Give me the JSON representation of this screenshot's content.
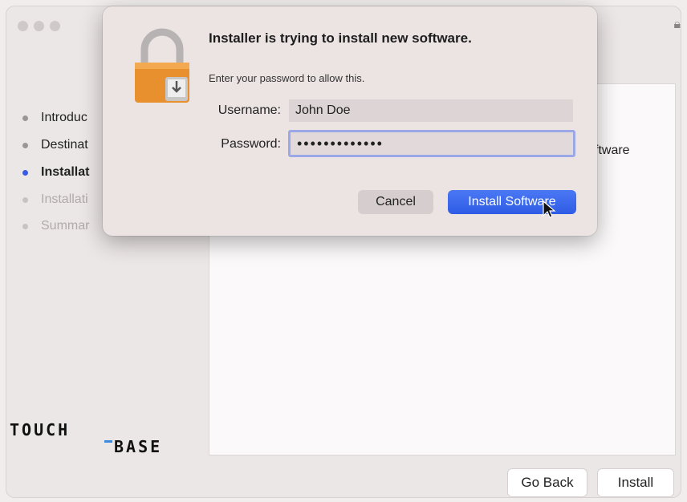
{
  "window": {
    "steps": [
      {
        "label": "Introduc",
        "state": "done"
      },
      {
        "label": "Destinat",
        "state": "done"
      },
      {
        "label": "Installat",
        "state": "active"
      },
      {
        "label": "Installati",
        "state": "pending"
      },
      {
        "label": "Summar",
        "state": "pending"
      }
    ],
    "content_text": "ftware",
    "go_back_label": "Go Back",
    "install_label": "Install",
    "logo_top": "TOUCH",
    "logo_bottom": "BASE"
  },
  "dialog": {
    "title": "Installer is trying to install new software.",
    "subtitle": "Enter your password to allow this.",
    "username_label": "Username:",
    "username_value": "John Doe",
    "password_label": "Password:",
    "password_value": "•••••••••••••",
    "cancel_label": "Cancel",
    "install_software_label": "Install Software"
  },
  "colors": {
    "accent": "#3a66ec",
    "active_step": "#3a5be0",
    "lock_orange": "#e8902e"
  }
}
